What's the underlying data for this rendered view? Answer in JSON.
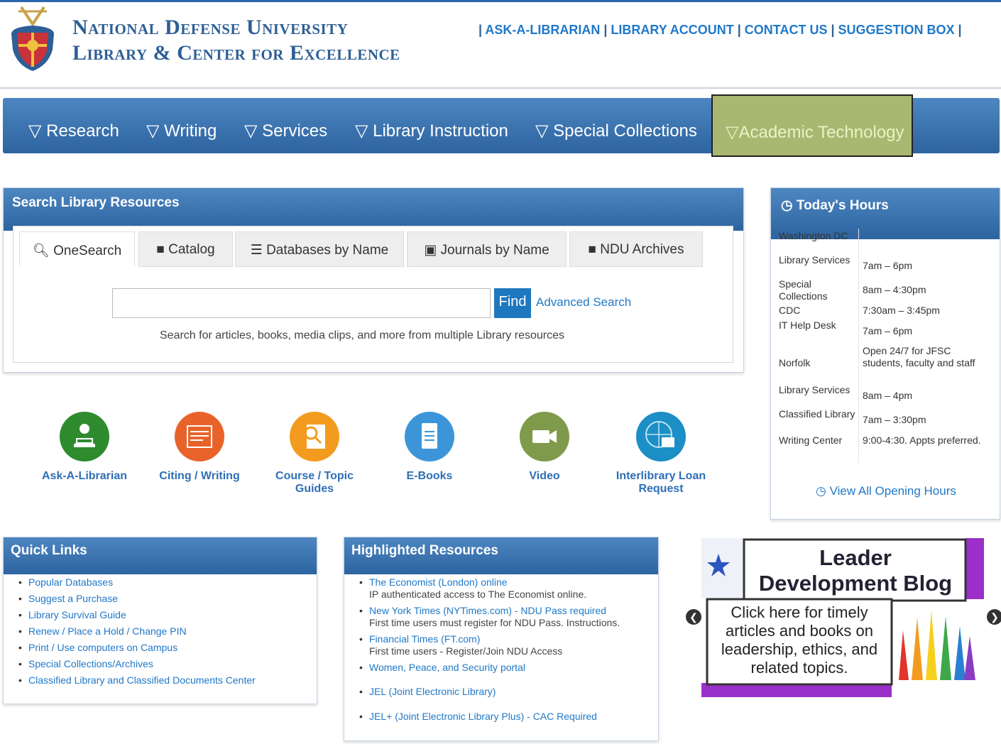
{
  "header": {
    "title_line1": "National Defense University",
    "title_line2": "Library & Center for Excellence",
    "top_links": [
      "ASK-A-LIBRARIAN",
      "LIBRARY ACCOUNT",
      "CONTACT US",
      "SUGGESTION BOX"
    ]
  },
  "nav": {
    "items": [
      "▽ Research",
      "▽ Writing",
      "▽ Services",
      "▽ Library Instruction",
      "▽ Special Collections"
    ],
    "active": "▽Academic Technology",
    "active_color": "#a9b770"
  },
  "search": {
    "title": "Search Library Resources",
    "tabs": [
      "OneSearch",
      "Catalog",
      "Databases by Name",
      "Journals by Name",
      "NDU Archives"
    ],
    "input_value": "",
    "find_label": "Find",
    "advanced_label": "Advanced Search",
    "help_text": "Search for articles, books, media clips, and more from multiple Library resources"
  },
  "quick_icons": [
    {
      "label1": "Ask-A-Librarian",
      "label2": "",
      "color": "#2e8b2e"
    },
    {
      "label1": "Citing / Writing",
      "label2": "",
      "color": "#e8632a"
    },
    {
      "label1": "Course / Topic",
      "label2": "Guides",
      "color": "#f39b1f"
    },
    {
      "label1": "E-Books",
      "label2": "",
      "color": "#3c95d8"
    },
    {
      "label1": "Video",
      "label2": "",
      "color": "#7f9a4a"
    },
    {
      "label1": "Interlibrary Loan",
      "label2": "Request",
      "color": "#1b8fc6"
    }
  ],
  "hours": {
    "title": "Today's Hours",
    "rows": [
      {
        "label": "Washington DC",
        "value": ""
      },
      {
        "label": "Library Services",
        "value": "7am – 6pm"
      },
      {
        "label": "Special Collections",
        "value": "8am – 4:30pm"
      },
      {
        "label": "CDC",
        "value": "7:30am – 3:45pm"
      },
      {
        "label": "IT Help Desk",
        "value": "7am – 6pm"
      },
      {
        "label": "Norfolk",
        "value": "Open 24/7 for JFSC students, faculty and staff"
      },
      {
        "label": "Library Services",
        "value": "8am – 4pm"
      },
      {
        "label": "Classified Library",
        "value": "7am – 3:30pm"
      },
      {
        "label": "Writing Center",
        "value": "9:00-4:30. Appts preferred."
      }
    ],
    "view_all": "View All Opening Hours"
  },
  "quick_links": {
    "title": "Quick Links",
    "items": [
      "Popular Databases",
      "Suggest a Purchase",
      "Library Survival Guide",
      "Renew / Place a Hold / Change PIN",
      "Print / Use computers on Campus",
      "Special Collections/Archives",
      "Classified Library and Classified Documents Center"
    ]
  },
  "highlighted": {
    "title": "Highlighted Resources",
    "items": [
      {
        "link": "The Economist (London) online",
        "sub": "IP authenticated access to The Economist online."
      },
      {
        "link": "New York Times (NYTimes.com) - NDU Pass required",
        "sub": "First time users must register for NDU Pass. Instructions."
      },
      {
        "link": "Financial Times (FT.com)",
        "sub": "First time users - Register/Join NDU Access"
      },
      {
        "link": "Women, Peace, and Security portal",
        "sub": ""
      },
      {
        "link": "JEL (Joint Electronic Library)",
        "sub": ""
      },
      {
        "link": "JEL+ (Joint Electronic Library Plus) - CAC Required",
        "sub": ""
      }
    ]
  },
  "blog": {
    "title_line1": "Leader",
    "title_line2": "Development Blog",
    "body": [
      "Click here for timely",
      "articles and books on",
      "leadership, ethics, and",
      "related topics."
    ]
  }
}
